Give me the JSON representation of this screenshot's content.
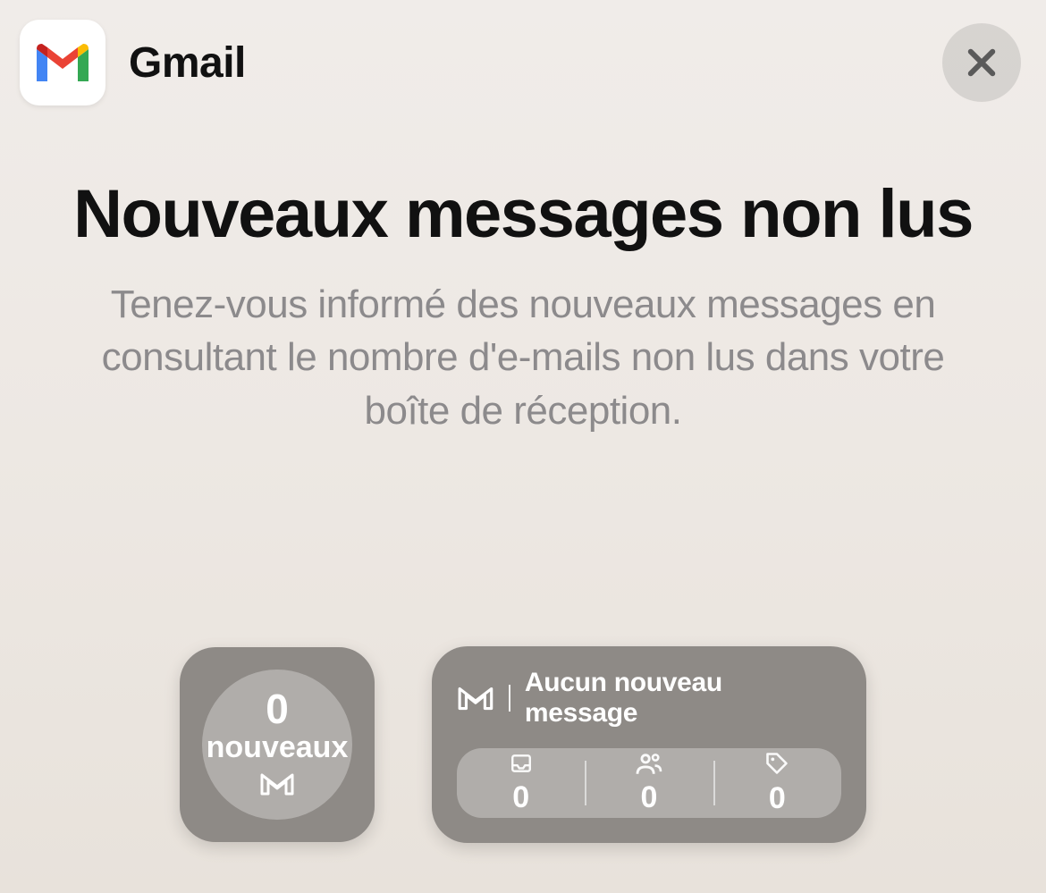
{
  "header": {
    "app_name": "Gmail"
  },
  "hero": {
    "title": "Nouveaux messages non lus",
    "subtitle": "Tenez-vous informé des nouveaux messages en consultant le nombre d'e-mails non lus dans votre boîte de réception."
  },
  "widget_small": {
    "count": "0",
    "label": "nouveaux"
  },
  "widget_medium": {
    "title": "Aucun nouveau message",
    "cells": {
      "primary": "0",
      "social": "0",
      "promotions": "0"
    }
  }
}
